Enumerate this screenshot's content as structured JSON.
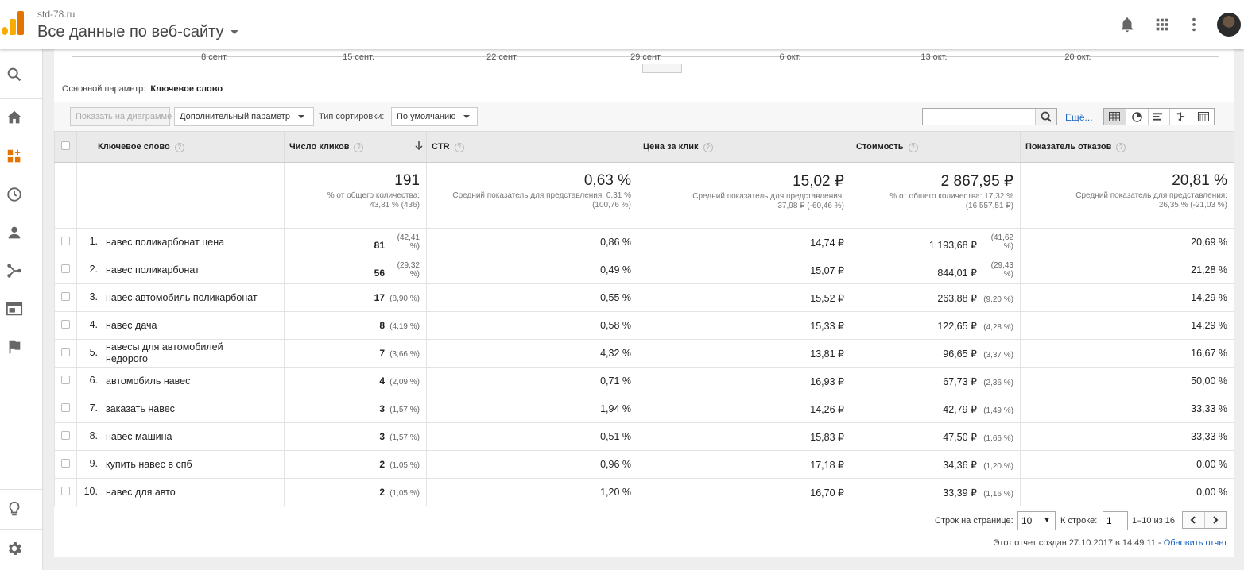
{
  "header": {
    "site": "std-78.ru",
    "title": "Все данные по веб-сайту"
  },
  "colors": {
    "accent_orange": "#f9ab00",
    "logo_dark_orange": "#e37400",
    "link_blue": "#1a66c4"
  },
  "sidebar": {
    "icons": [
      "search-icon",
      "home-icon",
      "dashboard-icon",
      "clock-icon",
      "user-icon",
      "acquisition-icon",
      "behavior-icon",
      "flag-icon",
      "lightbulb-icon",
      "gear-icon"
    ]
  },
  "timeline": {
    "labels": [
      "8 сент.",
      "15 сент.",
      "22 сент.",
      "29 сент.",
      "6 окт.",
      "13 окт.",
      "20 окт."
    ]
  },
  "primary": {
    "label": "Основной параметр:",
    "value": "Ключевое слово"
  },
  "toolbar": {
    "plot_button": "Показать на диаграмме",
    "secondary_dim": "Дополнительный параметр",
    "sort_label": "Тип сортировки:",
    "sort_value": "По умолчанию",
    "more": "Ещё..."
  },
  "table": {
    "headers": {
      "keyword": "Ключевое слово",
      "clicks": "Число кликов",
      "ctr": "CTR",
      "cpc": "Цена за клик",
      "cost": "Стоимость",
      "bounce": "Показатель отказов"
    },
    "totals": {
      "clicks": "191",
      "clicks_sub1": "% от общего количества:",
      "clicks_sub2": "43,81 % (436)",
      "ctr": "0,63 %",
      "ctr_sub1": "Средний показатель для представления: 0,31 %",
      "ctr_sub2": "(100,76 %)",
      "cpc": "15,02 ₽",
      "cpc_sub1": "Средний показатель для представления:",
      "cpc_sub2": "37,98 ₽ (-60,46 %)",
      "cost": "2 867,95 ₽",
      "cost_sub1": "% от общего количества: 17,32 %",
      "cost_sub2": "(16 557,51 ₽)",
      "bounce": "20,81 %",
      "bounce_sub1": "Средний показатель для представления:",
      "bounce_sub2": "26,35 % (-21,03 %)"
    },
    "rows": [
      {
        "idx": "1.",
        "kw": "навес поликарбонат цена",
        "clicks": "81",
        "clicks_pct": "(42,41 %)",
        "ctr": "0,86 %",
        "cpc": "14,74 ₽",
        "cost": "1 193,68 ₽",
        "cost_pct": "(41,62 %)",
        "bounce": "20,69 %"
      },
      {
        "idx": "2.",
        "kw": "навес поликарбонат",
        "clicks": "56",
        "clicks_pct": "(29,32 %)",
        "ctr": "0,49 %",
        "cpc": "15,07 ₽",
        "cost": "844,01 ₽",
        "cost_pct": "(29,43 %)",
        "bounce": "21,28 %"
      },
      {
        "idx": "3.",
        "kw": "навес автомобиль поликарбонат",
        "clicks": "17",
        "clicks_pct": "(8,90 %)",
        "ctr": "0,55 %",
        "cpc": "15,52 ₽",
        "cost": "263,88 ₽",
        "cost_pct": "(9,20 %)",
        "bounce": "14,29 %"
      },
      {
        "idx": "4.",
        "kw": "навес дача",
        "clicks": "8",
        "clicks_pct": "(4,19 %)",
        "ctr": "0,58 %",
        "cpc": "15,33 ₽",
        "cost": "122,65 ₽",
        "cost_pct": "(4,28 %)",
        "bounce": "14,29 %"
      },
      {
        "idx": "5.",
        "kw": "навесы для автомобилей недорого",
        "kw1": "навесы для автомобилей",
        "kw2": "недорого",
        "clicks": "7",
        "clicks_pct": "(3,66 %)",
        "ctr": "4,32 %",
        "cpc": "13,81 ₽",
        "cost": "96,65 ₽",
        "cost_pct": "(3,37 %)",
        "bounce": "16,67 %"
      },
      {
        "idx": "6.",
        "kw": "автомобиль навес",
        "clicks": "4",
        "clicks_pct": "(2,09 %)",
        "ctr": "0,71 %",
        "cpc": "16,93 ₽",
        "cost": "67,73 ₽",
        "cost_pct": "(2,36 %)",
        "bounce": "50,00 %"
      },
      {
        "idx": "7.",
        "kw": "заказать навес",
        "clicks": "3",
        "clicks_pct": "(1,57 %)",
        "ctr": "1,94 %",
        "cpc": "14,26 ₽",
        "cost": "42,79 ₽",
        "cost_pct": "(1,49 %)",
        "bounce": "33,33 %"
      },
      {
        "idx": "8.",
        "kw": "навес машина",
        "clicks": "3",
        "clicks_pct": "(1,57 %)",
        "ctr": "0,51 %",
        "cpc": "15,83 ₽",
        "cost": "47,50 ₽",
        "cost_pct": "(1,66 %)",
        "bounce": "33,33 %"
      },
      {
        "idx": "9.",
        "kw": "купить навес в спб",
        "clicks": "2",
        "clicks_pct": "(1,05 %)",
        "ctr": "0,96 %",
        "cpc": "17,18 ₽",
        "cost": "34,36 ₽",
        "cost_pct": "(1,20 %)",
        "bounce": "0,00 %"
      },
      {
        "idx": "10.",
        "kw": "навес для авто",
        "clicks": "2",
        "clicks_pct": "(1,05 %)",
        "ctr": "1,20 %",
        "cpc": "16,70 ₽",
        "cost": "33,39 ₽",
        "cost_pct": "(1,16 %)",
        "bounce": "0,00 %"
      }
    ]
  },
  "footer": {
    "rows_label": "Строк на странице:",
    "rows_value": "10",
    "goto_label": "К строке:",
    "goto_value": "1",
    "range": "1–10 из 16",
    "created": "Этот отчет создан 27.10.2017 в 14:49:11 -",
    "refresh": "Обновить отчет"
  }
}
